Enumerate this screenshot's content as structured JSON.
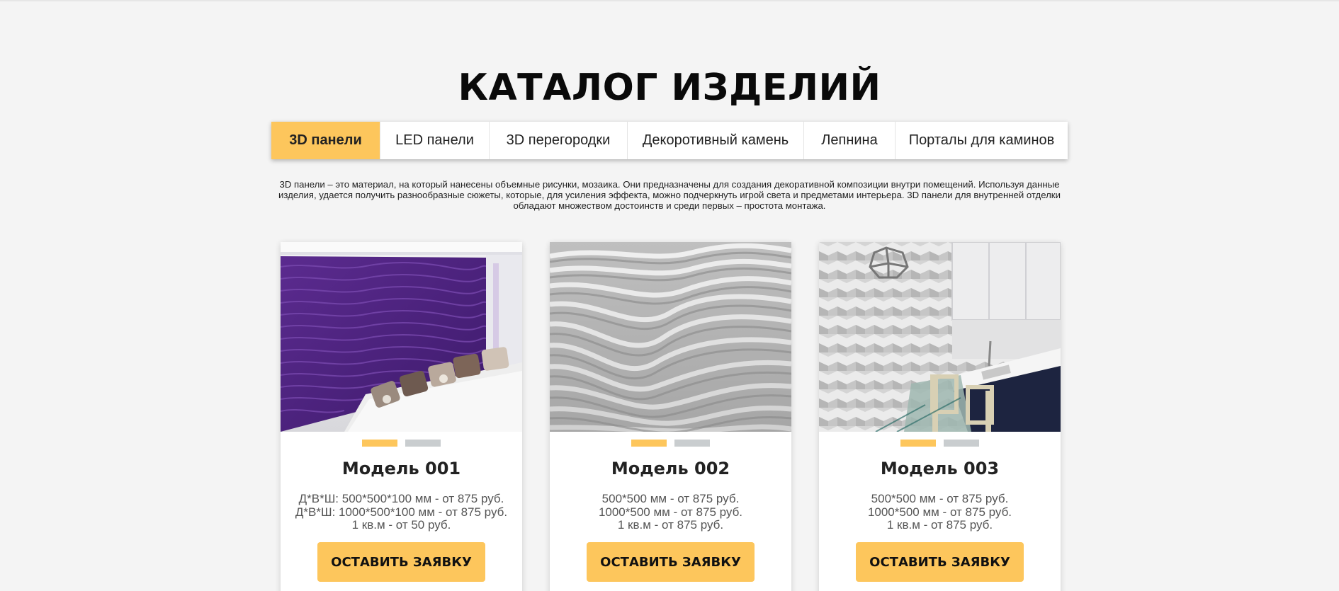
{
  "catalog": {
    "title": "КАТАЛОГ ИЗДЕЛИЙ"
  },
  "tabs": [
    {
      "label": "3D панели",
      "active": true
    },
    {
      "label": "LED панели",
      "active": false
    },
    {
      "label": "3D перегородки",
      "active": false
    },
    {
      "label": "Декоротивный камень",
      "active": false
    },
    {
      "label": "Лепнина",
      "active": false
    },
    {
      "label": "Порталы для каминов",
      "active": false
    }
  ],
  "description": "3D панели – это материал, на который нанесены объемные рисунки, мозаика. Они предназначены для создания декоративной композиции внутри помещений. Используя данные изделия, удается получить разнообразные сюжеты, которые, для усиления эффекта, можно подчеркнуть игрой света и предметами интерьера. 3D панели для внутренней отделки обладают множеством достоинств и среди первых – простота монтажа.",
  "products": [
    {
      "title": "Модель 001",
      "specs": [
        "Д*В*Ш: 500*500*100 мм - от 875 руб.",
        "Д*В*Ш: 1000*500*100 мм - от 875 руб.",
        "1 кв.м - от 50 руб."
      ],
      "button": "ОСТАВИТЬ ЗАЯВКУ",
      "slide_count": 2,
      "active_slide": 1
    },
    {
      "title": "Модель 002",
      "specs": [
        "500*500 мм - от 875 руб.",
        "1000*500 мм - от 875 руб.",
        "1 кв.м - от 875 руб."
      ],
      "button": "ОСТАВИТЬ ЗАЯВКУ",
      "slide_count": 2,
      "active_slide": 1
    },
    {
      "title": "Модель 003",
      "specs": [
        "500*500 мм - от 875 руб.",
        "1000*500 мм - от 875 руб.",
        "1 кв.м - от 875 руб."
      ],
      "button": "ОСТАВИТЬ ЗАЯВКУ",
      "slide_count": 2,
      "active_slide": 1
    }
  ],
  "colors": {
    "accent": "#fdc65c",
    "inactive_dot": "#c9cdcf",
    "background": "#f4f4f4"
  }
}
